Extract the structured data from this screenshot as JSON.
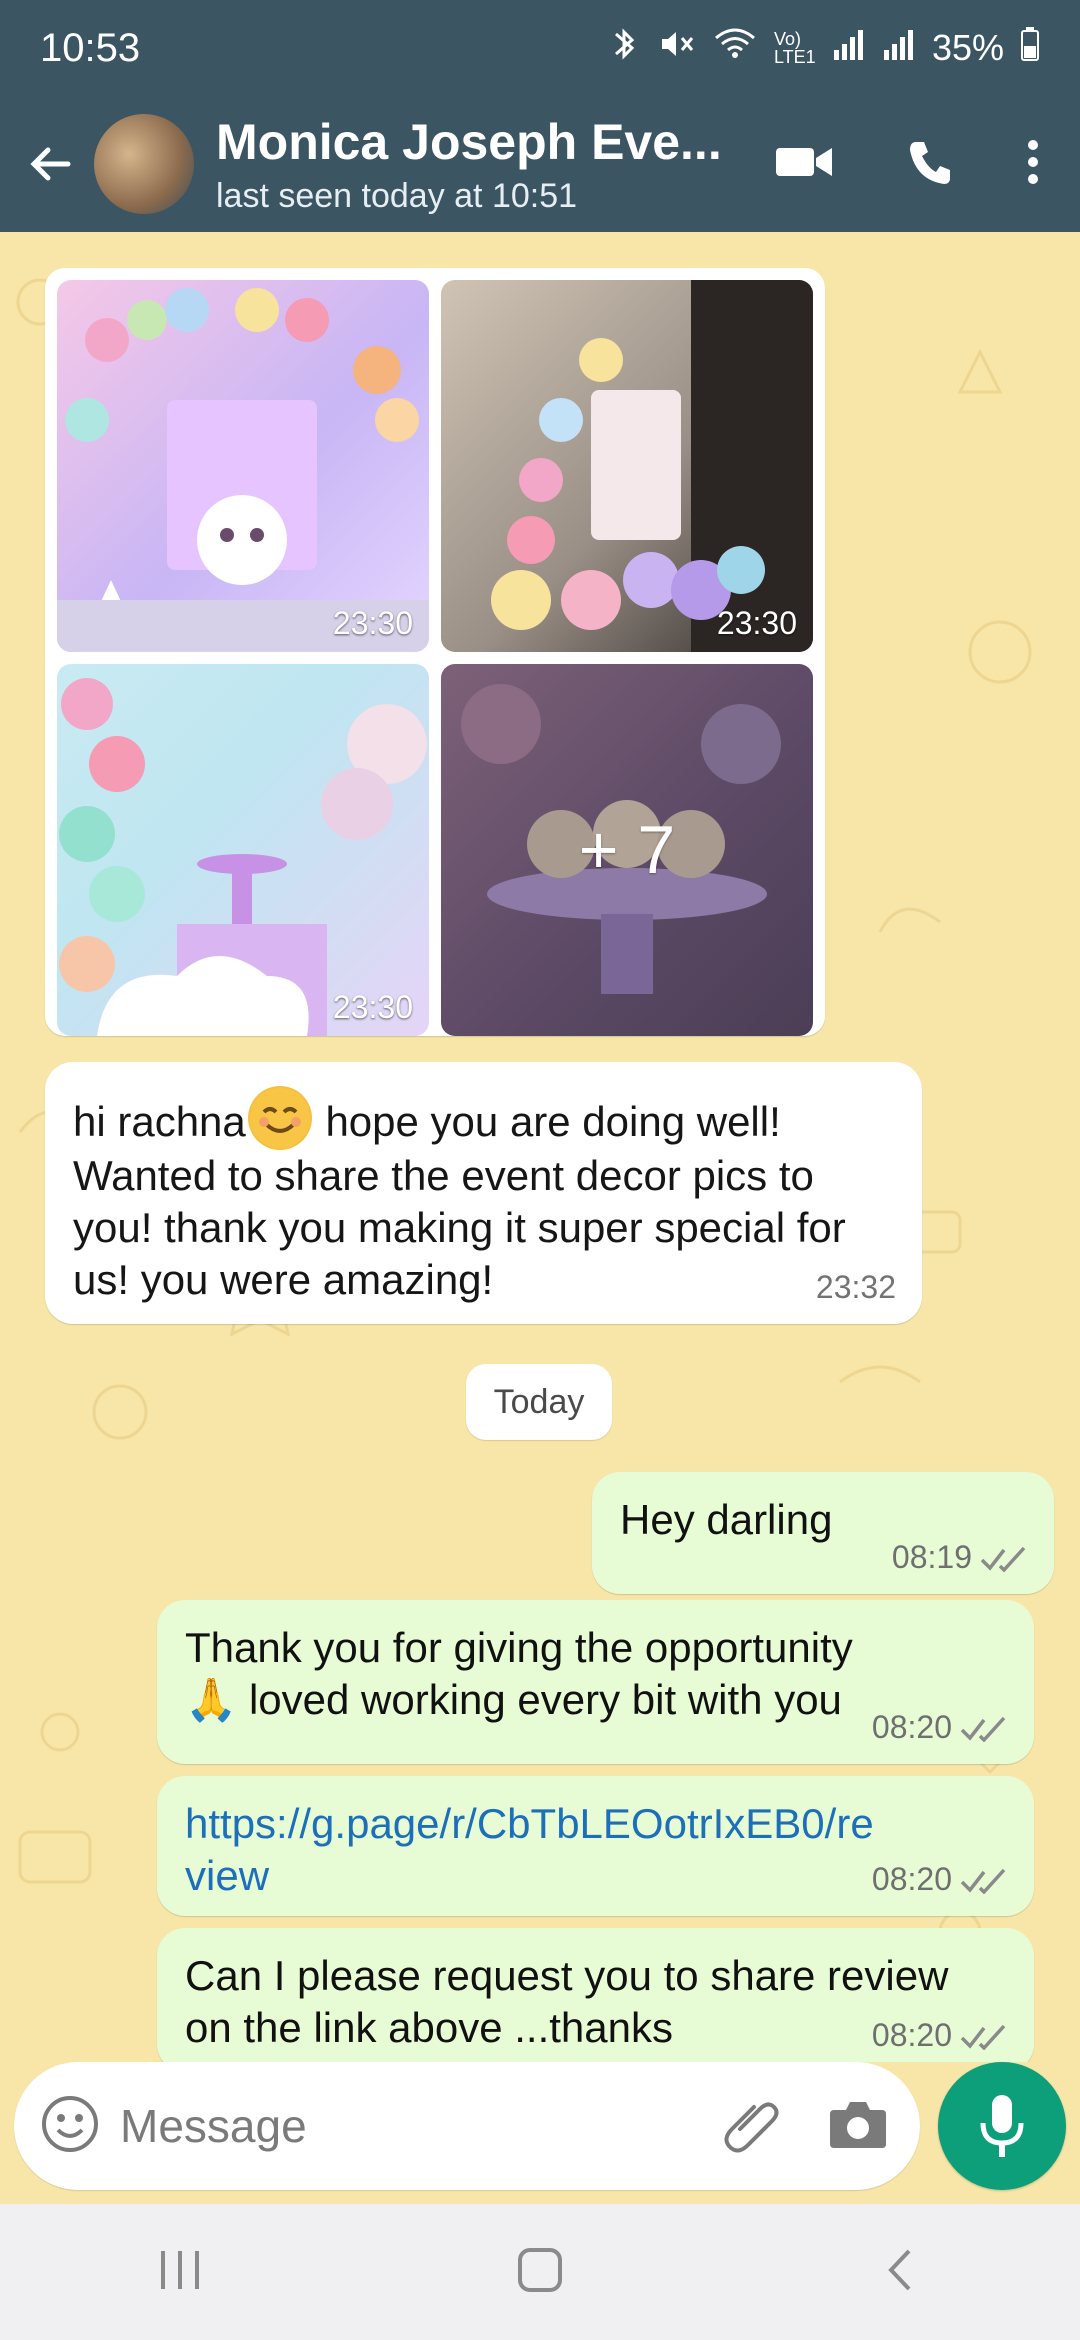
{
  "status": {
    "time": "10:53",
    "battery": "35%",
    "net_label": "Vo) LTE1"
  },
  "header": {
    "contact_name": "Monica Joseph Eve...",
    "last_seen": "last seen today at 10:51"
  },
  "media": {
    "tiles": [
      {
        "time": "23:30"
      },
      {
        "time": "23:30"
      },
      {
        "time": "23:30"
      },
      {
        "more": "+ 7"
      }
    ]
  },
  "incoming": {
    "part1": "hi rachna",
    "part2": " hope you are doing well! Wanted to share the event decor pics to you! thank you making it super special for us! you were amazing!",
    "time": "23:32"
  },
  "date_chip": "Today",
  "outgoing": [
    {
      "text": "Hey darling",
      "time": "08:19"
    },
    {
      "text": "Thank you for giving the opportunity 🙏 loved working every bit with you",
      "time": "08:20"
    },
    {
      "text": "https://g.page/r/CbTbLEOotrIxEB0/review",
      "time": "08:20",
      "is_link": true
    },
    {
      "text": "Can I please request you to share review on the link above ...thanks",
      "time": "08:20"
    }
  ],
  "composer": {
    "placeholder": "Message"
  },
  "colors": {
    "header_bg": "#3b5563",
    "chat_bg": "#f7e6a8",
    "outgoing_bubble": "#e7fcd5",
    "mic_button": "#0d9e7a",
    "link": "#1c6fb8"
  }
}
